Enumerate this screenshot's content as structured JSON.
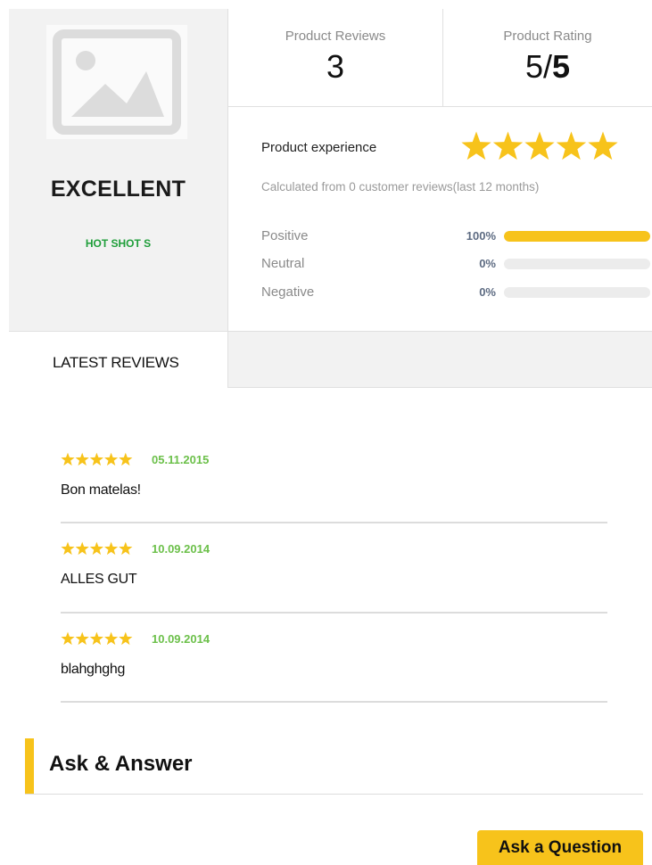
{
  "summary": {
    "rating_word": "EXCELLENT",
    "product_name": "HOT SHOT S",
    "product_reviews": {
      "label": "Product Reviews",
      "value": "3"
    },
    "product_rating": {
      "label": "Product Rating",
      "value": "5/",
      "max": "5"
    },
    "experience": {
      "label": "Product experience",
      "stars": 5,
      "star_color": "#f7c31b"
    },
    "calculated_text": "Calculated from 0 customer reviews(last 12 months)",
    "distribution": [
      {
        "label": "Positive",
        "percent_text": "100%",
        "percent": 100
      },
      {
        "label": "Neutral",
        "percent_text": "0%",
        "percent": 0
      },
      {
        "label": "Negative",
        "percent_text": "0%",
        "percent": 0
      }
    ]
  },
  "tabs": {
    "latest_reviews": "LATEST REVIEWS"
  },
  "reviews": [
    {
      "stars": 5,
      "date": "05.11.2015",
      "text": "Bon matelas!"
    },
    {
      "stars": 5,
      "date": "10.09.2014",
      "text": "ALLES GUT"
    },
    {
      "stars": 5,
      "date": "10.09.2014",
      "text": "blahghghg"
    }
  ],
  "ask": {
    "title": "Ask & Answer",
    "button_label": "Ask a Question"
  },
  "colors": {
    "accent": "#f7c31b",
    "date_green": "#6cc04a",
    "product_green": "#1f9e3a"
  },
  "icons": {
    "product_image": "image-placeholder-icon",
    "star": "star-icon"
  }
}
